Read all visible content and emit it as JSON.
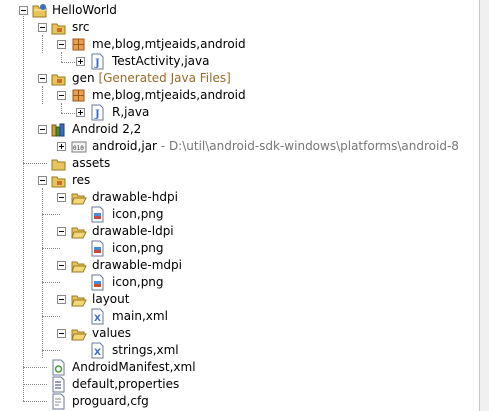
{
  "tree": {
    "root": {
      "label": "HelloWorld"
    },
    "src": {
      "label": "src",
      "package": {
        "label": "me,blog,mtjeaids,android"
      },
      "file": {
        "label": "TestActivity,java"
      }
    },
    "gen": {
      "label": "gen",
      "decoration": "[Generated Java Files]",
      "package": {
        "label": "me,blog,mtjeaids,android"
      },
      "file": {
        "label": "R,java"
      }
    },
    "android": {
      "label": "Android 2,2",
      "jar": {
        "label": "android,jar",
        "path": " - D:\\util\\android-sdk-windows\\platforms\\android-8"
      }
    },
    "assets": {
      "label": "assets"
    },
    "res": {
      "label": "res",
      "drawable_hdpi": {
        "label": "drawable-hdpi",
        "file": "icon,png"
      },
      "drawable_ldpi": {
        "label": "drawable-ldpi",
        "file": "icon,png"
      },
      "drawable_mdpi": {
        "label": "drawable-mdpi",
        "file": "icon,png"
      },
      "layout": {
        "label": "layout",
        "file": "main,xml"
      },
      "values": {
        "label": "values",
        "file": "strings,xml"
      }
    },
    "manifest": {
      "label": "AndroidManifest,xml"
    },
    "default_properties": {
      "label": "default,properties"
    },
    "proguard": {
      "label": "proguard,cfg"
    }
  },
  "colors": {
    "folder": "#e8c45a",
    "package": "#c8702a",
    "java": "#3a6ec6",
    "decoration": "#9a6a2a"
  }
}
